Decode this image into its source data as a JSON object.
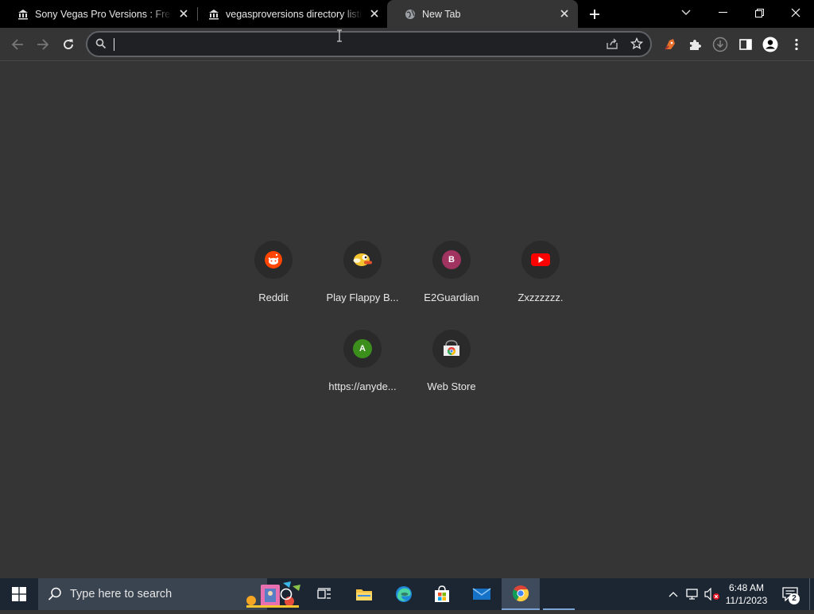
{
  "tabs": [
    {
      "title": "Sony Vegas Pro Versions : Free D",
      "favicon": "archive-icon",
      "active": false
    },
    {
      "title": "vegasproversions directory listin",
      "favicon": "archive-icon",
      "active": false
    },
    {
      "title": "New Tab",
      "favicon": "globe-icon",
      "active": true
    }
  ],
  "omnibox": {
    "value": "",
    "placeholder": ""
  },
  "shortcuts": [
    {
      "label": "Reddit",
      "icon": "reddit-icon",
      "color": "#ff4500"
    },
    {
      "label": "Play Flappy B...",
      "icon": "flappy-bird-icon",
      "color": "#f4c430"
    },
    {
      "label": "E2Guardian",
      "icon": "letter-b-icon",
      "letter": "B",
      "color": "#a0335f"
    },
    {
      "label": "Zxzzzzzz.",
      "icon": "youtube-icon",
      "color": "#ff0000"
    },
    {
      "label": "https://anyde...",
      "icon": "letter-a-icon",
      "letter": "A",
      "color": "#3c8f1c"
    },
    {
      "label": "Web Store",
      "icon": "web-store-icon",
      "color": "#4285f4"
    }
  ],
  "taskbar": {
    "search_placeholder": "Type here to search",
    "time": "6:48 AM",
    "date": "11/1/2023",
    "notification_count": "2"
  },
  "colors": {
    "background": "#353535",
    "tab_strip": "#000000",
    "taskbar": "#1c2633",
    "accent": "#1a73e8"
  }
}
